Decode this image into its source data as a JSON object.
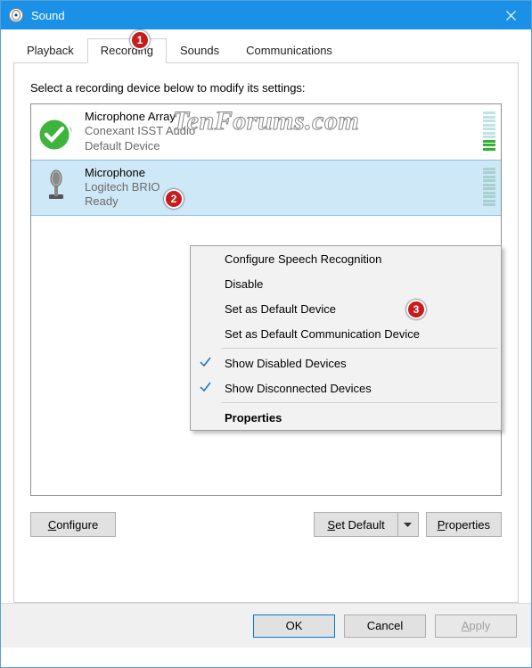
{
  "titlebar": {
    "title": "Sound"
  },
  "tabs": {
    "playback": "Playback",
    "recording": "Recording",
    "sounds": "Sounds",
    "communications": "Communications"
  },
  "instruction": "Select a recording device below to modify its settings:",
  "devices": [
    {
      "name": "Microphone Array",
      "sub1": "Conexant ISST Audio",
      "sub2": "Default Device",
      "meterActive": true
    },
    {
      "name": "Microphone",
      "sub1": "Logitech BRIO",
      "sub2": "Ready",
      "meterActive": false
    }
  ],
  "buttons": {
    "configure_u": "C",
    "configure": "onfigure",
    "setdefault_u": "S",
    "setdefault": "et Default",
    "props_u": "P",
    "props": "roperties",
    "ok": "OK",
    "cancel": "Cancel",
    "apply_u": "A",
    "apply": "pply"
  },
  "context": {
    "items": {
      "csr": "Configure Speech Recognition",
      "disable": "Disable",
      "default_dev": "Set as Default Device",
      "default_comm": "Set as Default Communication Device",
      "show_disabled": "Show Disabled Devices",
      "show_disconnected": "Show Disconnected Devices",
      "properties": "Properties"
    }
  },
  "markers": {
    "m1": "1",
    "m2": "2",
    "m3": "3"
  },
  "watermark": "TenForums.com"
}
